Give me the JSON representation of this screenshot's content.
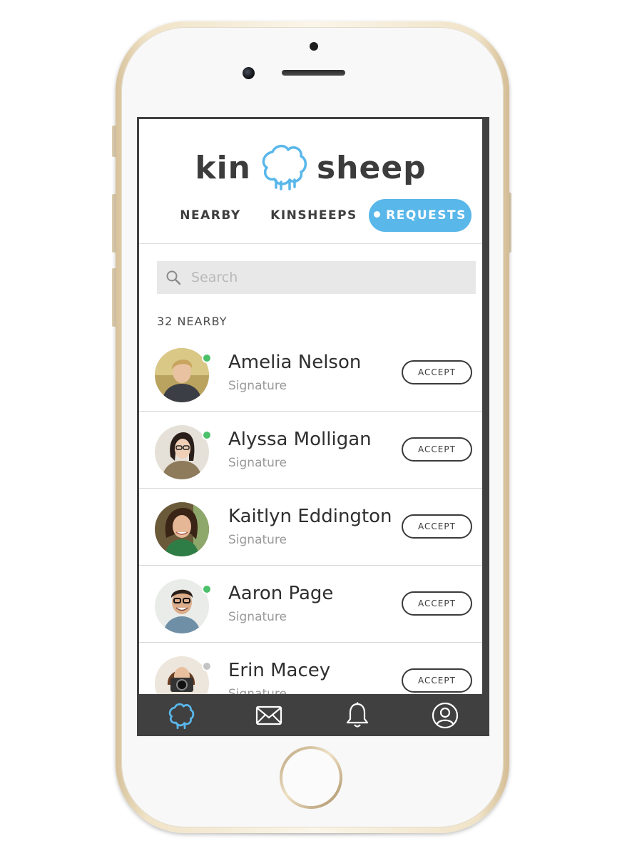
{
  "app": {
    "logo_left": "kin",
    "logo_right": "sheep"
  },
  "tabs": [
    {
      "label": "NEARBY",
      "active": false
    },
    {
      "label": "KINSHEEPS",
      "active": false
    },
    {
      "label": "REQUESTS",
      "active": true
    }
  ],
  "search": {
    "placeholder": "Search"
  },
  "count_label": "32 NEARBY",
  "requests": [
    {
      "name": "Amelia Nelson",
      "signature": "Signature",
      "online": true,
      "action": "ACCEPT"
    },
    {
      "name": "Alyssa Molligan",
      "signature": "Signature",
      "online": true,
      "action": "ACCEPT"
    },
    {
      "name": "Kaitlyn Eddington",
      "signature": "Signature",
      "online": false,
      "action": "ACCEPT"
    },
    {
      "name": "Aaron Page",
      "signature": "Signature",
      "online": true,
      "action": "ACCEPT"
    },
    {
      "name": "Erin Macey",
      "signature": "Signature",
      "online": false,
      "action": "ACCEPT"
    }
  ],
  "bottom_nav": [
    {
      "icon": "sheep-icon",
      "active": true
    },
    {
      "icon": "envelope-icon",
      "active": false
    },
    {
      "icon": "bell-icon",
      "active": false
    },
    {
      "icon": "user-icon",
      "active": false
    }
  ],
  "colors": {
    "accent": "#59b7ea",
    "online": "#4cc06a",
    "offline": "#c4c4c4",
    "nav_bg": "#404040"
  }
}
